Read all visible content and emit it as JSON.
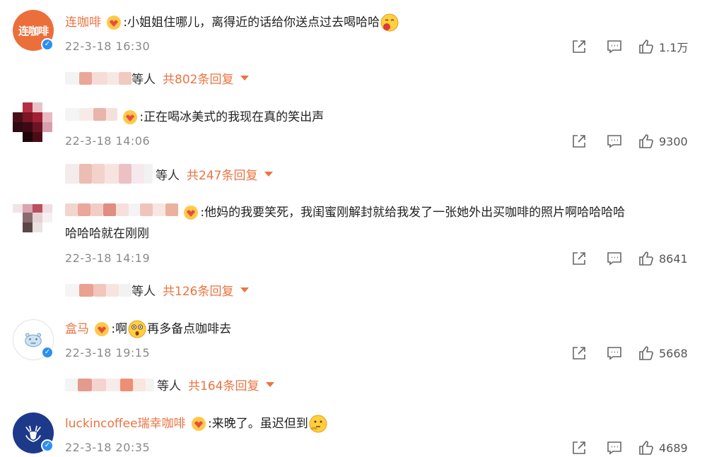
{
  "comments": [
    {
      "username": "连咖啡",
      "text": ":小姐姐住哪儿，离得近的话给你送点过去喝哈哈",
      "time": "22-3-18 16:30",
      "likes": "1.1万",
      "reply_suffix": "等人",
      "reply_count": "共802条回复"
    },
    {
      "username": "",
      "text": ":正在喝冰美式的我现在真的笑出声",
      "time": "22-3-18 14:06",
      "likes": "9300",
      "reply_suffix": "等人",
      "reply_count": "共247条回复"
    },
    {
      "username": "",
      "text": ":他妈的我要笑死，我闺蜜刚解封就给我发了一张她外出买咖啡的照片啊哈哈哈哈",
      "text2": "哈哈哈就在刚刚",
      "time": "22-3-18 14:19",
      "likes": "8641",
      "reply_suffix": "等人",
      "reply_count": "共126条回复"
    },
    {
      "username": "盒马",
      "text_a": ":啊",
      "text_b": "再多备点咖啡去",
      "time": "22-3-18 19:15",
      "likes": "5668",
      "reply_suffix": "等人",
      "reply_count": "共164条回复"
    },
    {
      "username": "luckincoffee瑞幸咖啡",
      "text": ":来晚了。虽迟但到",
      "time": "22-3-18 20:35",
      "likes": "4689"
    }
  ],
  "avatar_texts": {
    "lian": "连咖啡"
  },
  "colors": {
    "username": "#eb7340",
    "verified": "#2c8ff2",
    "time": "#8a8a8a"
  },
  "icons": [
    "share-icon",
    "comment-icon",
    "thumb-up-icon",
    "verified-icon",
    "fan-badge-icon",
    "emoji-icon",
    "chevron-down-icon"
  ]
}
